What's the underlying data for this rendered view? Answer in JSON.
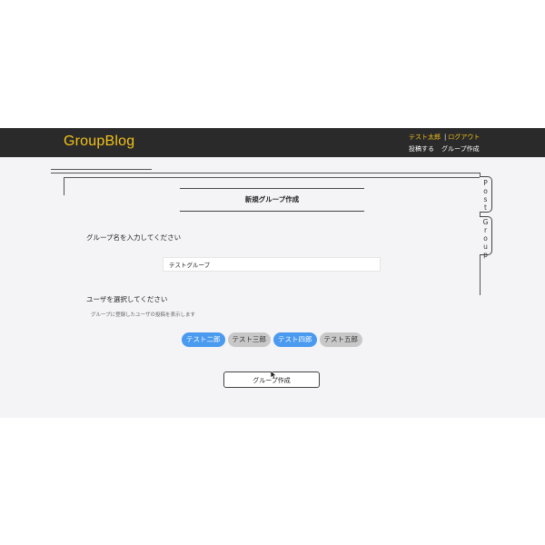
{
  "header": {
    "brand": "GroupBlog",
    "user_name": "テスト太郎",
    "separator": "|",
    "logout": "ログアウト",
    "nav": [
      "投稿する",
      "グループ作成"
    ]
  },
  "side_tabs": {
    "post": [
      "P",
      "o",
      "s",
      "t"
    ],
    "group": [
      "G",
      "r",
      "o",
      "u",
      "p"
    ]
  },
  "form": {
    "title": "新規グループ作成",
    "group_name_label": "グループ名を入力してください",
    "group_name_value": "テストグループ",
    "user_select_label": "ユーザを選択してください",
    "user_select_hint": "グループに登録したユーザの投稿を表示します",
    "users": [
      {
        "name": "テスト二郎",
        "selected": true
      },
      {
        "name": "テスト三郎",
        "selected": false
      },
      {
        "name": "テスト四郎",
        "selected": true
      },
      {
        "name": "テスト五郎",
        "selected": false
      }
    ],
    "submit_label": "グループ作成"
  },
  "colors": {
    "header_bg": "#2a2a2a",
    "brand": "#f2c21a",
    "chip_selected": "#4a9af0",
    "chip_unselected": "#c8c8c8"
  }
}
